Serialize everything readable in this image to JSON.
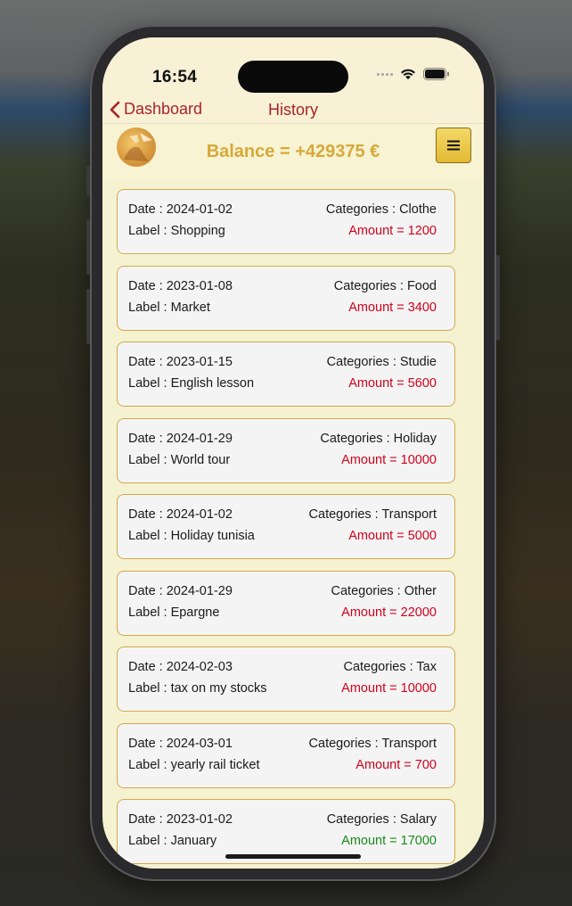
{
  "status_bar": {
    "time": "16:54"
  },
  "nav": {
    "back_label": "Dashboard",
    "title": "History"
  },
  "header": {
    "balance": "Balance = +429375 €"
  },
  "colors": {
    "accent": "#a8232a",
    "expense": "#d0021b",
    "income": "#1a8a1a",
    "balance": "#d7a93a",
    "card_border": "#d3a94a"
  },
  "transactions": [
    {
      "date": "Date : 2024-01-02",
      "category": "Categories : Clothe",
      "label": "Label : Shopping",
      "amount": "Amount = 1200",
      "type": "expense"
    },
    {
      "date": "Date : 2023-01-08",
      "category": "Categories : Food",
      "label": "Label : Market",
      "amount": "Amount = 3400",
      "type": "expense"
    },
    {
      "date": "Date : 2023-01-15",
      "category": "Categories : Studie",
      "label": "Label : English lesson",
      "amount": "Amount = 5600",
      "type": "expense"
    },
    {
      "date": "Date : 2024-01-29",
      "category": "Categories : Holiday",
      "label": "Label : World tour",
      "amount": "Amount = 10000",
      "type": "expense"
    },
    {
      "date": "Date : 2024-01-02",
      "category": "Categories : Transport",
      "label": "Label : Holiday tunisia",
      "amount": "Amount = 5000",
      "type": "expense"
    },
    {
      "date": "Date : 2024-01-29",
      "category": "Categories : Other",
      "label": "Label : Epargne",
      "amount": "Amount = 22000",
      "type": "expense"
    },
    {
      "date": "Date : 2024-02-03",
      "category": "Categories : Tax",
      "label": "Label : tax on my stocks",
      "amount": "Amount = 10000",
      "type": "expense"
    },
    {
      "date": "Date : 2024-03-01",
      "category": "Categories : Transport",
      "label": "Label : yearly rail ticket",
      "amount": "Amount = 700",
      "type": "expense"
    },
    {
      "date": "Date : 2023-01-02",
      "category": "Categories : Salary",
      "label": "Label : January",
      "amount": "Amount = 17000",
      "type": "income"
    }
  ]
}
